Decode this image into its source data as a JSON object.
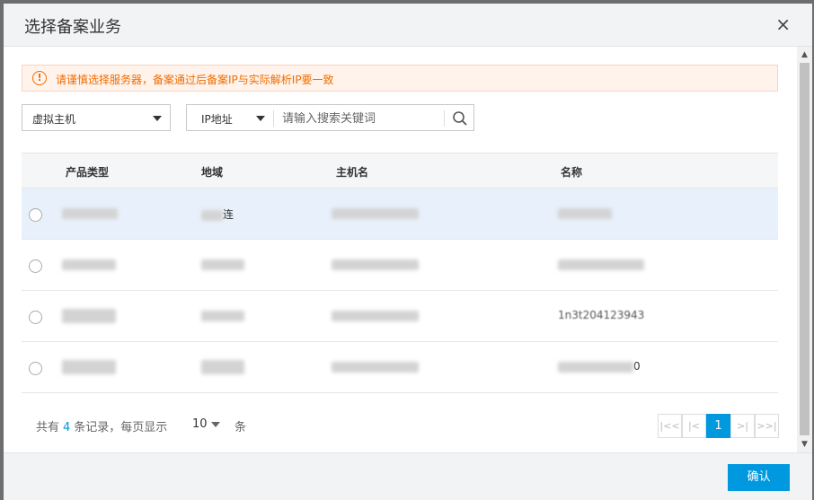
{
  "dialog": {
    "title": "选择备案业务",
    "close_label": "×"
  },
  "alert": {
    "icon": "exclamation-icon",
    "text": "请谨慎选择服务器，备案通过后备案IP与实际解析IP要一致"
  },
  "filters": {
    "product_select": "虚拟主机",
    "search_type": "IP地址",
    "search_placeholder": "请输入搜索关键词",
    "search_value": ""
  },
  "table": {
    "columns": [
      "产品类型",
      "地域",
      "主机名",
      "名称"
    ],
    "rows": [
      {
        "selected": true,
        "region_suffix": "连",
        "name_suffix": ""
      },
      {
        "selected": false,
        "region_suffix": "",
        "name_suffix": ""
      },
      {
        "selected": false,
        "region_suffix": "",
        "name_suffix": "1n3t204123943"
      },
      {
        "selected": false,
        "region_suffix": "",
        "name_suffix": "0"
      }
    ]
  },
  "pagination": {
    "info_prefix": "共有",
    "total": "4",
    "info_suffix": "条记录，每页显示",
    "page_size": "10",
    "unit": "条",
    "first": "|<<",
    "prev": "|<",
    "current_page": "1",
    "next": ">|",
    "last": ">>|"
  },
  "footer": {
    "confirm_label": "确认"
  },
  "colors": {
    "accent": "#0099dd",
    "warning": "#f06c00",
    "selected_row": "#e8f1fb"
  }
}
